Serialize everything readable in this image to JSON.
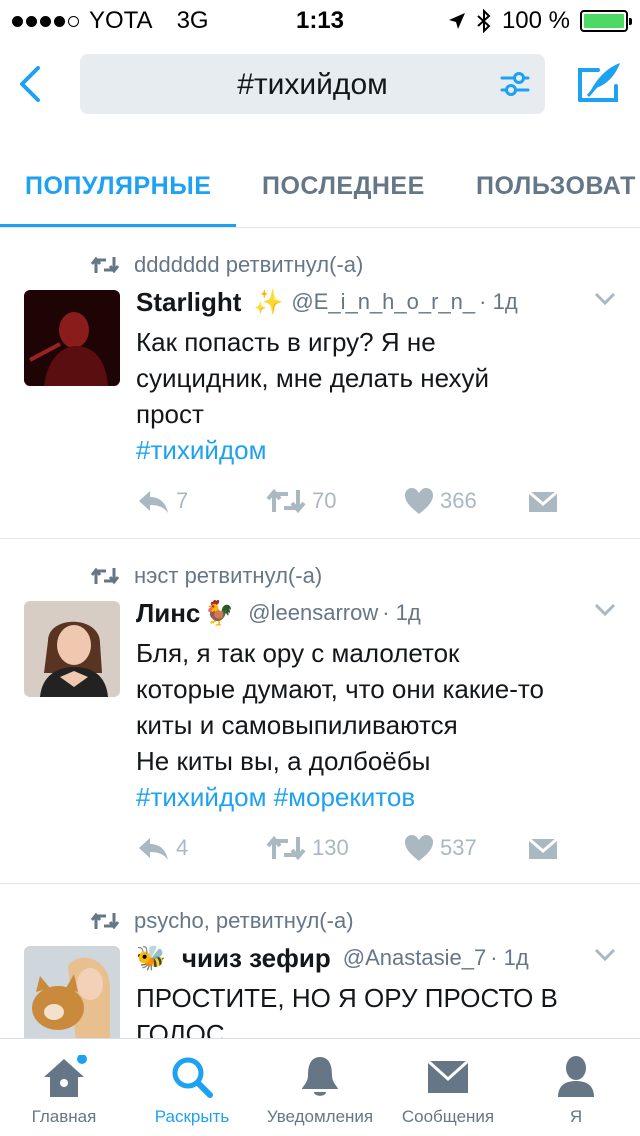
{
  "status_bar": {
    "carrier": "YOTA",
    "network": "3G",
    "time": "1:13",
    "battery": "100 %",
    "signal_bars": 4,
    "battery_level": 1.0
  },
  "header": {
    "query": "#тихийдом"
  },
  "tabs": [
    {
      "label": "ПОПУЛЯРНЫЕ",
      "active": true
    },
    {
      "label": "ПОСЛЕДНЕЕ",
      "active": false
    },
    {
      "label": "ПОЛЬЗОВАТ",
      "active": false
    }
  ],
  "tweets": [
    {
      "retweeted_by": "ddddddd ретвитнул(-а)",
      "name": "Starlight",
      "emoji": "✨",
      "handle": "@E_i_n_h_o_r_n_",
      "time": "· 1д",
      "text": "Как попасть в игру? Я не\nсуицидник, мне делать нехуй\nпрост",
      "hashtags": "#тихийдом",
      "replies": "7",
      "retweets": "70",
      "likes": "366"
    },
    {
      "retweeted_by": "нэст ретвитнул(-а)",
      "name": "Линс",
      "emoji": "🐓",
      "handle": "@leensarrow",
      "time": "· 1д",
      "text": "Бля, я так ору с малолеток\nкоторые думают, что они какие-то\nкиты и самовыпиливаются\nНе киты вы, а долбоёбы",
      "hashtags": "#тихийдом #морекитов",
      "replies": "4",
      "retweets": "130",
      "likes": "537"
    },
    {
      "retweeted_by": "psycho, ретвитнул(-а)",
      "name": "чииз зефир",
      "emoji": "🐝",
      "handle": "@Anastasie_7",
      "time": "· 1д",
      "text": "ПРОСТИТЕ, НО Я ОРУ ПРОСТО В\nГОЛОС"
    }
  ],
  "tabbar": [
    {
      "label": "Главная",
      "icon": "home-icon",
      "active": false
    },
    {
      "label": "Раскрыть",
      "icon": "search-icon",
      "active": true
    },
    {
      "label": "Уведомления",
      "icon": "bell-icon",
      "active": false
    },
    {
      "label": "Сообщения",
      "icon": "envelope-icon",
      "active": false
    },
    {
      "label": "Я",
      "icon": "person-icon",
      "active": false
    }
  ],
  "colors": {
    "accent": "#1da1f2",
    "muted": "#657786",
    "icon_gray": "#aab8c2",
    "battery": "#4cd964"
  }
}
